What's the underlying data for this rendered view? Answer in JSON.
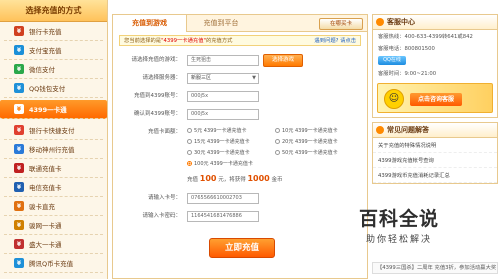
{
  "sidebar": {
    "title": "选择充值的方式",
    "items": [
      {
        "label": "银行卡充值",
        "icon": "bank-card-icon",
        "color": "#d04020"
      },
      {
        "label": "支付宝充值",
        "icon": "alipay-icon",
        "color": "#1a8fd8"
      },
      {
        "label": "微信支付",
        "icon": "wechat-icon",
        "color": "#2aa84a"
      },
      {
        "label": "QQ钱包支付",
        "icon": "qq-wallet-icon",
        "color": "#1e90d8"
      },
      {
        "label": "4399一卡通",
        "icon": "4399-card-icon",
        "color": "#ff7a00",
        "active": true
      },
      {
        "label": "银行卡快捷支付",
        "icon": "quick-pay-icon",
        "color": "#e04030"
      },
      {
        "label": "移动神州行充值",
        "icon": "mobile-icon",
        "color": "#2a7ad8"
      },
      {
        "label": "联通充值卡",
        "icon": "unicom-icon",
        "color": "#c02020"
      },
      {
        "label": "电信充值卡",
        "icon": "telecom-icon",
        "color": "#2060b0"
      },
      {
        "label": "骏卡直充",
        "icon": "jcard-icon",
        "color": "#e07010"
      },
      {
        "label": "骏网一卡通",
        "icon": "junnet-icon",
        "color": "#d08000"
      },
      {
        "label": "盛大一卡通",
        "icon": "shanda-icon",
        "color": "#c03030"
      },
      {
        "label": "腾讯Q币卡充值",
        "icon": "qcoin-icon",
        "color": "#1e90d8"
      }
    ]
  },
  "main": {
    "tabs": {
      "active": "充值到游戏",
      "other": "充值到平台"
    },
    "flash_button": "在哪买卡",
    "notice": {
      "pre": "您当前选择的是",
      "highlight": "\"4399一卡通充值\"",
      "post": "的充值方式",
      "link": "遇到问题? 请点击"
    },
    "fields": {
      "game_label": "请选择充值的游戏：",
      "game_value": "生死狙击",
      "game_button": "选择游戏",
      "server_label": "请选择服务器：",
      "server_value": "新服三区",
      "account_label": "充值到4399账号：",
      "account_value": "000j5x",
      "confirm_label": "确认到4399账号：",
      "confirm_value": "000j5x",
      "amount_label": "充值卡面额：",
      "card_label": "请输入卡号：",
      "card_value": "0765566610002703",
      "pwd_label": "请输入卡密码：",
      "pwd_value": "1164541681476886"
    },
    "denominations": [
      {
        "label": "5元 4399一卡通充值卡",
        "selected": false
      },
      {
        "label": "10元 4399一卡通充值卡",
        "selected": false
      },
      {
        "label": "15元 4399一卡通充值卡",
        "selected": false
      },
      {
        "label": "20元 4399一卡通充值卡",
        "selected": false
      },
      {
        "label": "30元 4399一卡通充值卡",
        "selected": false
      },
      {
        "label": "50元 4399一卡通充值卡",
        "selected": false
      },
      {
        "label": "100元 4399一卡通充值卡",
        "selected": true
      }
    ],
    "price": {
      "pre": "充值",
      "yuan": "100",
      "mid": "元，将获得",
      "coins": "1000",
      "post": "金币"
    },
    "submit": "立即充值"
  },
  "right": {
    "service_title": "客服中心",
    "hotline": "客服热线：400-633-4399转641或842",
    "phone": "客服电话：800801500",
    "qq_label": "QQ在线",
    "hours": "客服时间：9:00~21:00",
    "banner_text": "点击咨询客服",
    "faq_title": "常见问题解答",
    "faq": [
      "关于充值的特殊情况说明",
      "4399游戏充值帐号查询",
      "4399游戏币充值消耗记录汇总"
    ],
    "ticker": "【4399三国杀】二周年 充值3折，参加活动赢大奖"
  },
  "watermark": {
    "big": "百科全说",
    "small": "助你轻松解决"
  }
}
